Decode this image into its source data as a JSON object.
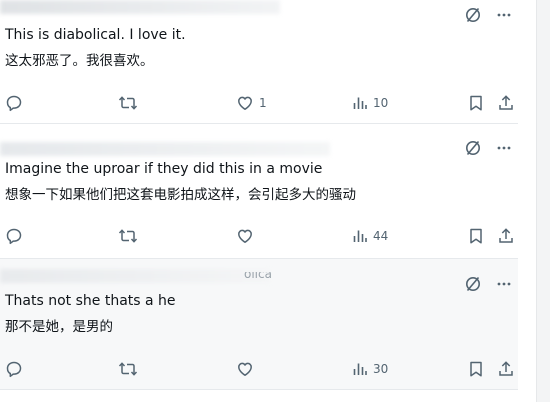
{
  "posts": [
    {
      "text_en": "This is diabolical. I love it.",
      "text_zh": "这太邪恶了。我很喜欢。",
      "likes": "1",
      "views": "10"
    },
    {
      "text_en": "Imagine the uproar if they did this in a movie",
      "text_zh": "想象一下如果他们把这套电影拍成这样，会引起多大的骚动",
      "likes": "",
      "views": "44"
    },
    {
      "header_fragment": "olica",
      "text_en": "Thats not she thats a he",
      "text_zh": "那不是她，是男的",
      "likes": "",
      "views": "30"
    }
  ],
  "icons": {
    "reply": "reply-icon",
    "retweet": "retweet-icon",
    "like": "heart-icon",
    "views": "views-icon",
    "bookmark": "bookmark-icon",
    "share": "share-icon",
    "translate_off": "grok-slash-icon",
    "more": "more-icon"
  },
  "colors": {
    "icon": "#536471",
    "text": "#0f1419",
    "divider": "#e6e9ec"
  }
}
